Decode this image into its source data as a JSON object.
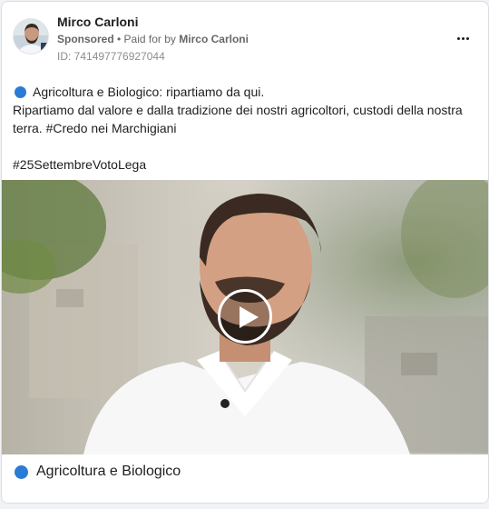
{
  "ad": {
    "page_name": "Mirco Carloni",
    "sponsored_label": "Sponsored",
    "paid_for_prefix": "• Paid for by",
    "payer": "Mirco Carloni",
    "ad_id": "ID: 741497776927044"
  },
  "post": {
    "headline": "Agricoltura e Biologico: ripartiamo da qui.",
    "body": "Ripartiamo dal valore e dalla tradizione dei nostri agricoltori, custodi della nostra terra. #Credo nei Marchigiani",
    "hashtag": "#25SettembreVotoLega"
  },
  "media": {
    "type": "video",
    "play_icon": "play-icon"
  },
  "caption": {
    "text": "Agricoltura e Biologico"
  },
  "colors": {
    "accent_blue": "#2b7bd6",
    "text_primary": "#1c1e21",
    "text_secondary": "#65676b"
  },
  "icons": {
    "more": "more-options-icon",
    "bullet": "blue-circle-emoji"
  }
}
